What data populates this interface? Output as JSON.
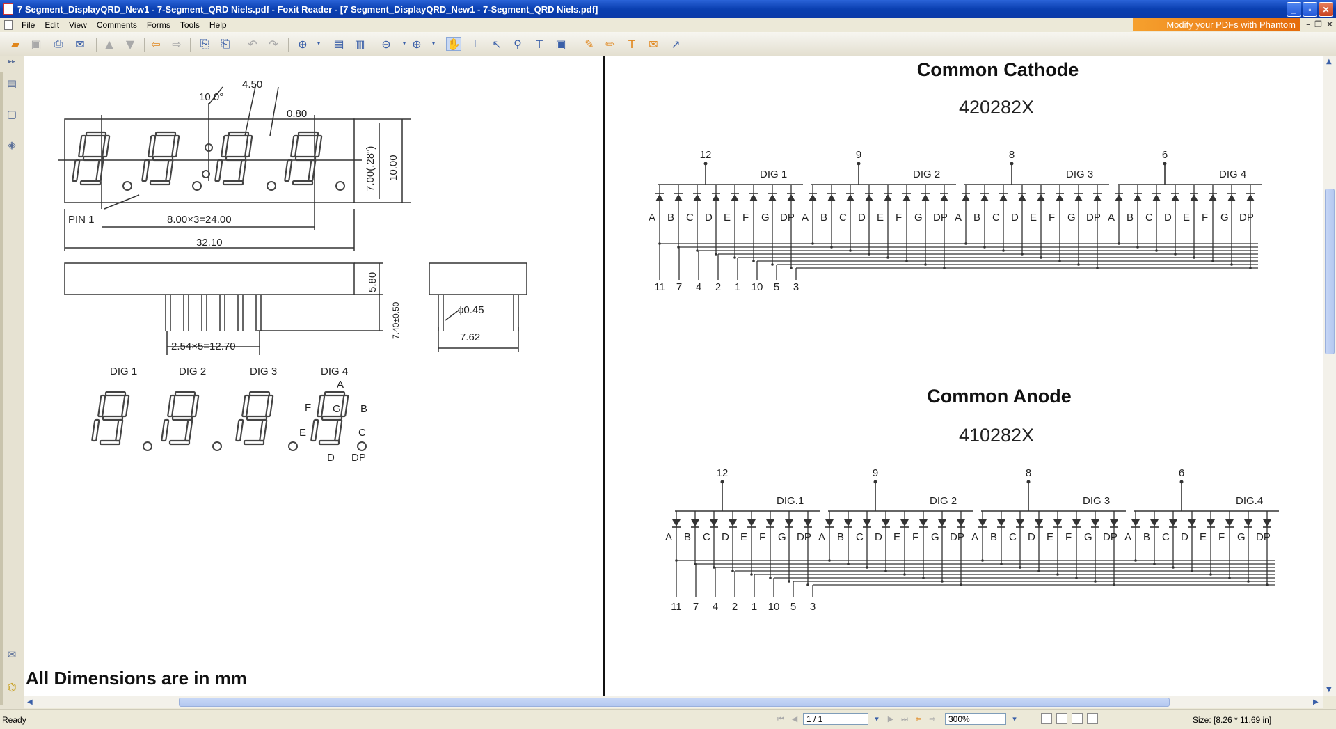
{
  "window": {
    "title": "7 Segment_DisplayQRD_New1 - 7-Segment_QRD Niels.pdf - Foxit Reader - [7 Segment_DisplayQRD_New1 - 7-Segment_QRD Niels.pdf]",
    "min": "_",
    "max": "▫",
    "close": "✕"
  },
  "menu": {
    "items": [
      "File",
      "Edit",
      "View",
      "Comments",
      "Forms",
      "Tools",
      "Help"
    ]
  },
  "promo": "Modify your PDFs with Phantom",
  "doc": {
    "left": {
      "dim_10": "10.0°",
      "dim_450": "4.50",
      "dim_080": "0.80",
      "dim_700": "7.00(.28\")",
      "dim_1000": "10.00",
      "pin1": "PIN 1",
      "dim_2400": "8.00×3=24.00",
      "dim_3210": "32.10",
      "dim_580": "5.80",
      "dim_740": "7.40±0.50",
      "dim_1270": "2.54×5=12.70",
      "dim_045": "ϕ0.45",
      "dim_762": "7.62",
      "digits": [
        "DIG 1",
        "DIG 2",
        "DIG 3",
        "DIG 4"
      ],
      "seg_labels": {
        "a": "A",
        "b": "B",
        "c": "C",
        "d": "D",
        "e": "E",
        "f": "F",
        "g": "G",
        "dp": "DP"
      },
      "footer": "All Dimensions are in mm"
    },
    "cathode": {
      "heading": "Common Cathode",
      "part": "420282X",
      "common_pins": [
        "12",
        "9",
        "8",
        "6"
      ],
      "dig_labels": [
        "DIG 1",
        "DIG 2",
        "DIG 3",
        "DIG 4"
      ],
      "segments": [
        "A",
        "B",
        "C",
        "D",
        "E",
        "F",
        "G",
        "DP"
      ],
      "bottom_pins": [
        "11",
        "7",
        "4",
        "2",
        "1",
        "10",
        "5",
        "3"
      ]
    },
    "anode": {
      "heading": "Common Anode",
      "part": "410282X",
      "common_pins": [
        "12",
        "9",
        "8",
        "6"
      ],
      "dig_labels": [
        "DIG.1",
        "DIG 2",
        "DIG 3",
        "DIG.4"
      ],
      "segments": [
        "A",
        "B",
        "C",
        "D",
        "E",
        "F",
        "G",
        "DP"
      ],
      "bottom_pins": [
        "11",
        "7",
        "4",
        "2",
        "1",
        "10",
        "5",
        "3"
      ]
    }
  },
  "status": {
    "ready": "Ready",
    "page": "1 / 1",
    "zoom": "300%",
    "size": "Size: [8.26 * 11.69 in]"
  }
}
